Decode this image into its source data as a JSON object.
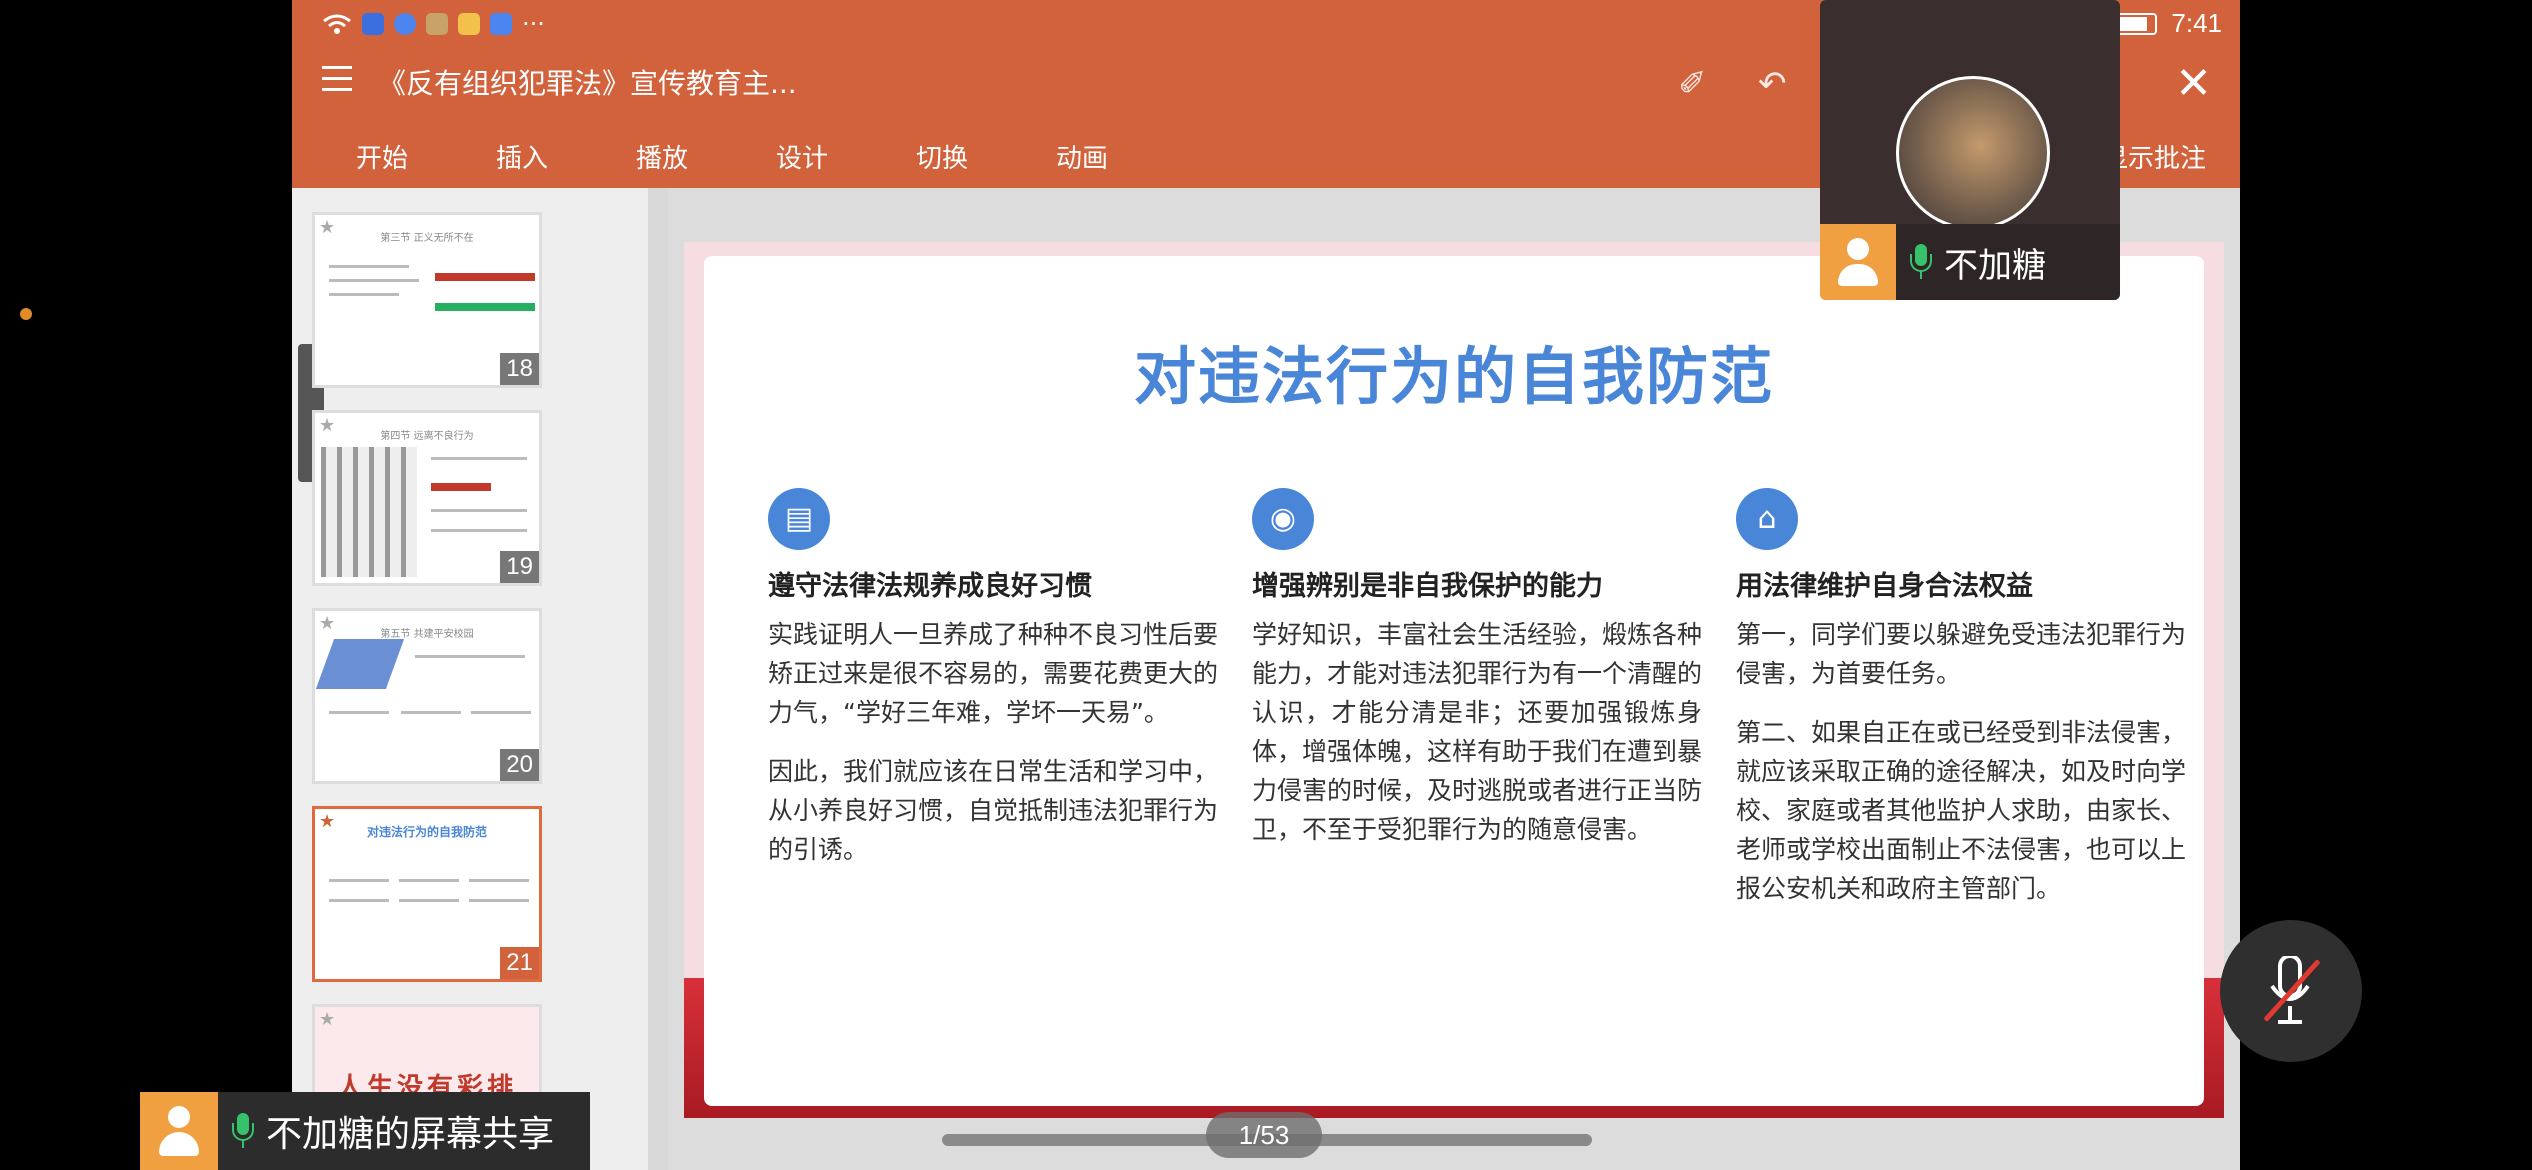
{
  "status_bar": {
    "time": "7:41"
  },
  "toolbar": {
    "doc_title": "《反有组织犯罪法》宣传教育主...",
    "close_glyph": "✕",
    "undo_glyph": "↶",
    "edit_glyph": "✐"
  },
  "ribbon": {
    "tabs": [
      "开始",
      "插入",
      "播放",
      "设计",
      "切换",
      "动画"
    ],
    "right_tab": "显示批注"
  },
  "thumbnails": [
    {
      "num": "18",
      "title": "第三节  正义无所不在"
    },
    {
      "num": "19",
      "title": "第四节  远离不良行为"
    },
    {
      "num": "20",
      "title": "第五节  共建平安校园"
    },
    {
      "num": "21",
      "title": "对违法行为的自我防范"
    },
    {
      "num": "",
      "title": "人生没有彩排"
    }
  ],
  "slide": {
    "title": "对违法行为的自我防范",
    "columns": [
      {
        "icon": "▤",
        "heading": "遵守法律法规养成良好习惯",
        "paragraphs": [
          "实践证明人一旦养成了种种不良习性后要矫正过来是很不容易的，需要花费更大的力气，“学好三年难，学坏一天易”。",
          "因此，我们就应该在日常生活和学习中，从小养良好习惯，自觉抵制违法犯罪行为的引诱。"
        ]
      },
      {
        "icon": "◉",
        "heading": "增强辨别是非自我保护的能力",
        "paragraphs": [
          "学好知识，丰富社会生活经验，煅炼各种能力，才能对违法犯罪行为有一个清醒的认识，才能分清是非；还要加强锻炼身体，增强体魄，这样有助于我们在遭到暴力侵害的时候，及时逃脱或者进行正当防卫，不至于受犯罪行为的随意侵害。"
        ]
      },
      {
        "icon": "⌂",
        "heading": "用法律维护自身合法权益",
        "paragraphs": [
          "第一，同学们要以躲避免受违法犯罪行为侵害，为首要任务。",
          "第二、如果自正在或已经受到非法侵害，就应该采取正确的途径解决，如及时向学校、家庭或者其他监护人求助，由家长、老师或学校出面制止不法侵害，也可以上报公安机关和政府主管部门。"
        ]
      }
    ]
  },
  "page_indicator": "1/53",
  "video": {
    "name": "不加糖"
  },
  "share": {
    "label": "不加糖的屏幕共享"
  },
  "colors": {
    "accent": "#d2623c",
    "slide_title": "#4a86d8",
    "mic": "#36c26a"
  },
  "icons": [
    "wifi-icon",
    "menu-icon",
    "close-icon",
    "undo-icon",
    "mic-icon",
    "mute-mic-icon",
    "person-icon",
    "battery-icon"
  ]
}
